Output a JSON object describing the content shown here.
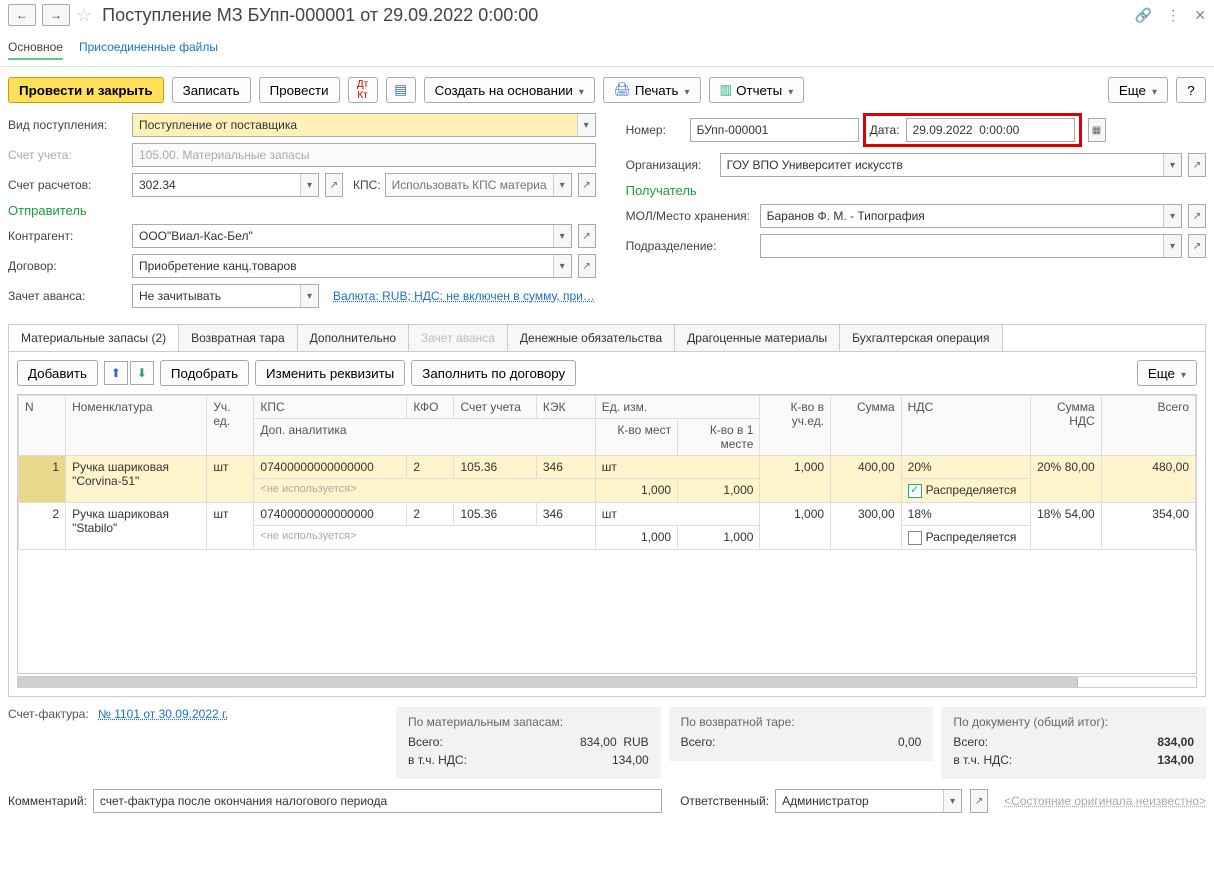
{
  "title": "Поступление МЗ БУпп-000001 от 29.09.2022 0:00:00",
  "main_tabs": {
    "main": "Основное",
    "attached": "Присоединенные файлы"
  },
  "toolbar": {
    "post_close": "Провести и закрыть",
    "save": "Записать",
    "post": "Провести",
    "create_based": "Создать на основании",
    "print": "Печать",
    "reports": "Отчеты",
    "more": "Еще",
    "help": "?"
  },
  "form": {
    "type_label": "Вид поступления:",
    "type_value": "Поступление от поставщика",
    "acct_label": "Счет учета:",
    "acct_value": "105.00. Материальные запасы",
    "settl_label": "Счет расчетов:",
    "settl_value": "302.34",
    "kps_label": "КПС:",
    "kps_placeholder": "Использовать КПС материалов",
    "sender_header": "Отправитель",
    "contr_label": "Контрагент:",
    "contr_value": "ООО\"Виал-Кас-Бел\"",
    "contract_label": "Договор:",
    "contract_value": "Приобретение канц.товаров",
    "advance_label": "Зачет аванса:",
    "advance_value": "Не зачитывать",
    "currency_link": "Валюта: RUB; НДС: не включен в сумму, при…",
    "num_label": "Номер:",
    "num_value": "БУпп-000001",
    "date_label": "Дата:",
    "date_value": "29.09.2022  0:00:00",
    "org_label": "Организация:",
    "org_value": "ГОУ ВПО Университет искусств",
    "recv_header": "Получатель",
    "mol_label": "МОЛ/Место хранения:",
    "mol_value": "Баранов Ф. М. - Типография",
    "dept_label": "Подразделение:",
    "dept_value": ""
  },
  "sub_tabs": {
    "materials": "Материальные запасы (2)",
    "tare": "Возвратная тара",
    "additional": "Дополнительно",
    "advance": "Зачет аванса",
    "money": "Денежные обязательства",
    "precious": "Драгоценные материалы",
    "accounting": "Бухгалтерская операция"
  },
  "tab_toolbar": {
    "add": "Добавить",
    "pick": "Подобрать",
    "edit_req": "Изменить реквизиты",
    "fill_contract": "Заполнить по договору",
    "more": "Еще"
  },
  "grid_headers": {
    "n": "N",
    "nomen": "Номенклатура",
    "unit": "Уч. ед.",
    "kps": "КПС",
    "kfo": "КФО",
    "acct": "Счет учета",
    "kek": "КЭК",
    "uom": "Ед. изм.",
    "qty": "К-во в уч.ед.",
    "sum": "Сумма",
    "vat": "НДС",
    "vat_sum": "Сумма НДС",
    "total": "Всего",
    "dop": "Доп. аналитика",
    "places": "К-во мест",
    "inplace": "К-во в 1 месте",
    "distrib": "Распределяется",
    "not_used": "<не используется>"
  },
  "grid_rows": [
    {
      "n": "1",
      "nomen": "Ручка шариковая \"Corvina-51\"",
      "unit": "шт",
      "kps": "07400000000000000",
      "kfo": "2",
      "acct": "105.36",
      "kek": "346",
      "uom": "шт",
      "qty": "1,000",
      "sum": "400,00",
      "vat": "20%",
      "vat_amt": "80,00",
      "vat_sum": "80,00",
      "total": "480,00",
      "places": "1,000",
      "inplace": "1,000",
      "distrib": true
    },
    {
      "n": "2",
      "nomen": "Ручка шариковая \"Stabilo\"",
      "unit": "шт",
      "kps": "07400000000000000",
      "kfo": "2",
      "acct": "105.36",
      "kek": "346",
      "uom": "шт",
      "qty": "1,000",
      "sum": "300,00",
      "vat": "18%",
      "vat_amt": "54,00",
      "vat_sum": "54,00",
      "total": "354,00",
      "places": "1,000",
      "inplace": "1,000",
      "distrib": false
    }
  ],
  "invoice": {
    "label": "Счет-фактура:",
    "link": "№ 1101 от 30.09.2022 г."
  },
  "totals": {
    "mat_head": "По материальным запасам:",
    "tare_head": "По возвратной таре:",
    "doc_head": "По документу (общий итог):",
    "total_label": "Всего:",
    "vat_label": "в т.ч. НДС:",
    "mat_total": "834,00",
    "mat_cur": "RUB",
    "mat_vat": "134,00",
    "tare_total": "0,00",
    "doc_total": "834,00",
    "doc_vat": "134,00"
  },
  "footer": {
    "comment_label": "Комментарий:",
    "comment_value": "счет-фактура после окончания налогового периода",
    "resp_label": "Ответственный:",
    "resp_value": "Администратор",
    "orig_state": "<Состояние оригинала неизвестно>"
  }
}
